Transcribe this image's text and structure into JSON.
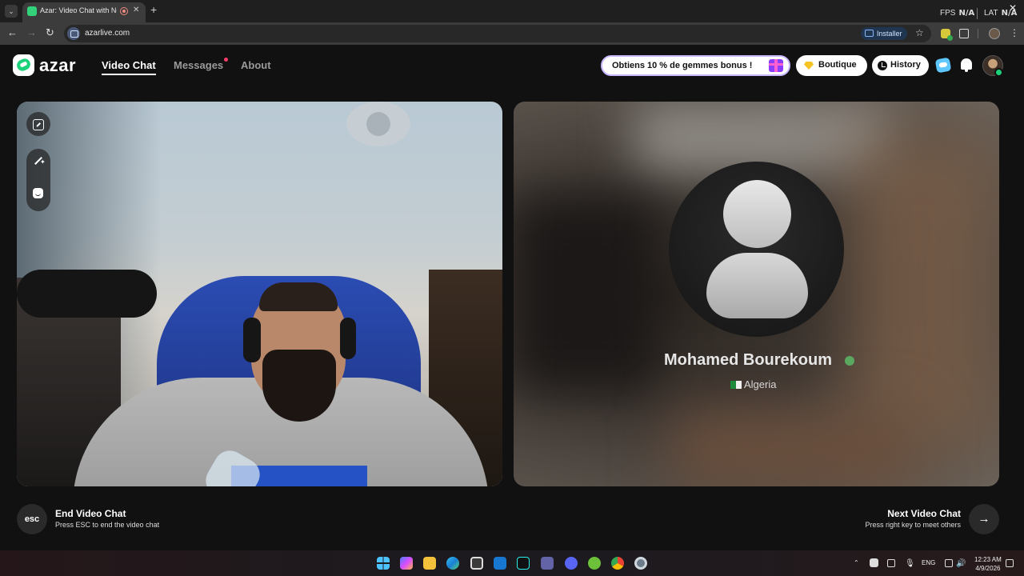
{
  "browser": {
    "tab_title": "Azar: Video Chat with New",
    "url": "azarlive.com",
    "install_label": "Installer",
    "fps_label": "FPS",
    "fps_value": "N/A",
    "lat_label": "LAT",
    "lat_value": "N/A"
  },
  "header": {
    "logo_text": "azar",
    "nav": [
      {
        "label": "Video Chat",
        "active": true
      },
      {
        "label": "Messages",
        "active": false,
        "has_notification": true
      },
      {
        "label": "About",
        "active": false
      }
    ],
    "promo_label": "Obtiens 10 % de gemmes bonus !",
    "shop_label": "Boutique",
    "history_label": "History"
  },
  "peer": {
    "name": "Mohamed Bourekoum",
    "country": "Algeria"
  },
  "controls": {
    "esc_key": "esc",
    "end_title": "End Video Chat",
    "end_sub": "Press ESC to end the video chat",
    "next_title": "Next Video Chat",
    "next_sub": "Press right key to meet others"
  },
  "taskbar": {
    "lang": "ENG",
    "time": "12:23 AM",
    "date": "4/9/2026",
    "icons": [
      "start-icon",
      "copilot-icon",
      "file-explorer-icon",
      "edge-icon",
      "store-icon",
      "outlook-icon",
      "tiktok-icon",
      "teams-icon",
      "discord-icon",
      "utorrent-icon",
      "chrome-icon",
      "settings-icon"
    ]
  },
  "colors": {
    "accent_green": "#1bd17a",
    "background": "#111111",
    "notification_dot": "#ff3d6b"
  }
}
